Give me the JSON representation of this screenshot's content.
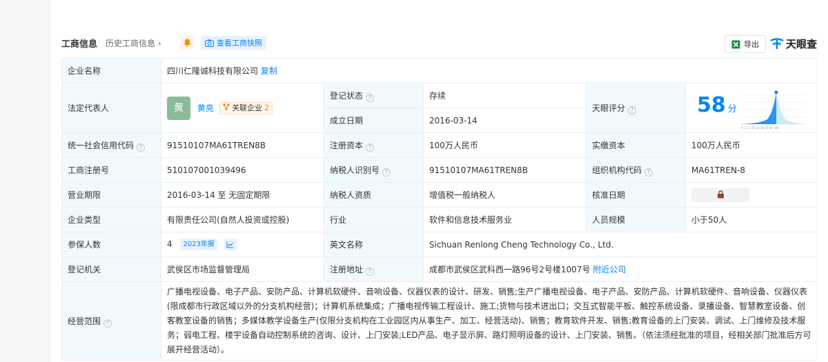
{
  "header": {
    "title": "工商信息",
    "history_link": "历史工商信息",
    "snapshot_button": "查看工商快照",
    "export_button": "导出",
    "brand": "天眼查"
  },
  "company": {
    "name_label": "企业名称",
    "name": "四川仁隆诚科技有限公司",
    "copy": "复制",
    "legal_rep_label": "法定代表人",
    "legal_rep_avatar": "黄",
    "legal_rep_name": "黄亮",
    "related_label": "关联企业",
    "related_count": "2",
    "status_label": "登记状态",
    "status": "存续",
    "founded_label": "成立日期",
    "founded": "2016-03-14",
    "score_label": "天眼评分",
    "score": "58",
    "score_unit": "分",
    "score_axis": [
      "0",
      "1",
      "2",
      "3",
      "10",
      "20",
      "40",
      "70",
      "90",
      "100"
    ],
    "credit_code_label": "统一社会信用代码",
    "credit_code": "91510107MA61TREN8B",
    "reg_capital_label": "注册资本",
    "reg_capital": "100万人民币",
    "paid_capital_label": "实缴资本",
    "paid_capital": "100万人民币",
    "reg_no_label": "工商注册号",
    "reg_no": "510107001039496",
    "taxpayer_id_label": "纳税人识别号",
    "taxpayer_id": "91510107MA61TREN8B",
    "org_code_label": "组织机构代码",
    "org_code": "MA61TREN-8",
    "term_label": "营业期限",
    "term": "2016-03-14 至 无固定期限",
    "taxpayer_qual_label": "纳税人资质",
    "taxpayer_qual": "增值税一般纳税人",
    "approve_date_label": "核准日期",
    "type_label": "企业类型",
    "type": "有限责任公司(自然人投资或控股)",
    "industry_label": "行业",
    "industry": "软件和信息技术服务业",
    "staff_label": "人员规模",
    "staff": "小于50人",
    "insured_label": "参保人数",
    "insured": "4",
    "report_tag": "2023年报",
    "english_label": "英文名称",
    "english": "Sichuan Renlong Cheng Technology Co., Ltd.",
    "authority_label": "登记机关",
    "authority": "武侯区市场监督管理局",
    "address_label": "注册地址",
    "address": "成都市武侯区武科西一路96号2号楼1007号",
    "nearby": "附近公司",
    "scope_label": "经营范围",
    "scope": "广播电视设备、电子产品、安防产品、计算机软硬件、音响设备、仪器仪表的设计、研发、销售;生产广播电视设备、电子产品、安防产品、计算机软硬件、音响设备、仪器仪表(限成都市行政区域以外的分支机构经营)；计算机系统集成；广播电视传输工程设计、施工;货物与技术进出口；交互式智能平板、触控系统设备、录播设备、智慧教室设备、创客教室设备的销售；多媒体教学设备生产(仅限分支机构在工业园区内从事生产、加工、经营活动)、销售；教育软件开发、销售;教育设备的上门安装、调试、上门维修及技术服务；弱电工程、楼宇设备自动控制系统的咨询、设计、上门安装;LED产品、电子显示屏、路灯照明设备的设计、上门安装、销售。（依法须经批准的项目，经相关部门批准后方可展开经营活动）。"
  },
  "colors": {
    "accent": "#0084ff",
    "label_bg": "#f2f9fc",
    "border": "#e4eef8",
    "status_green": "#1ba35f",
    "avatar_bg": "#88bc98",
    "tag_orange": "#ff7d00"
  },
  "icons": [
    "bell-icon",
    "camera-icon",
    "excel-icon",
    "brand-logo-icon",
    "question-icon",
    "relation-icon",
    "trend-chart-icon",
    "lock-icon",
    "chevron-right-icon"
  ]
}
